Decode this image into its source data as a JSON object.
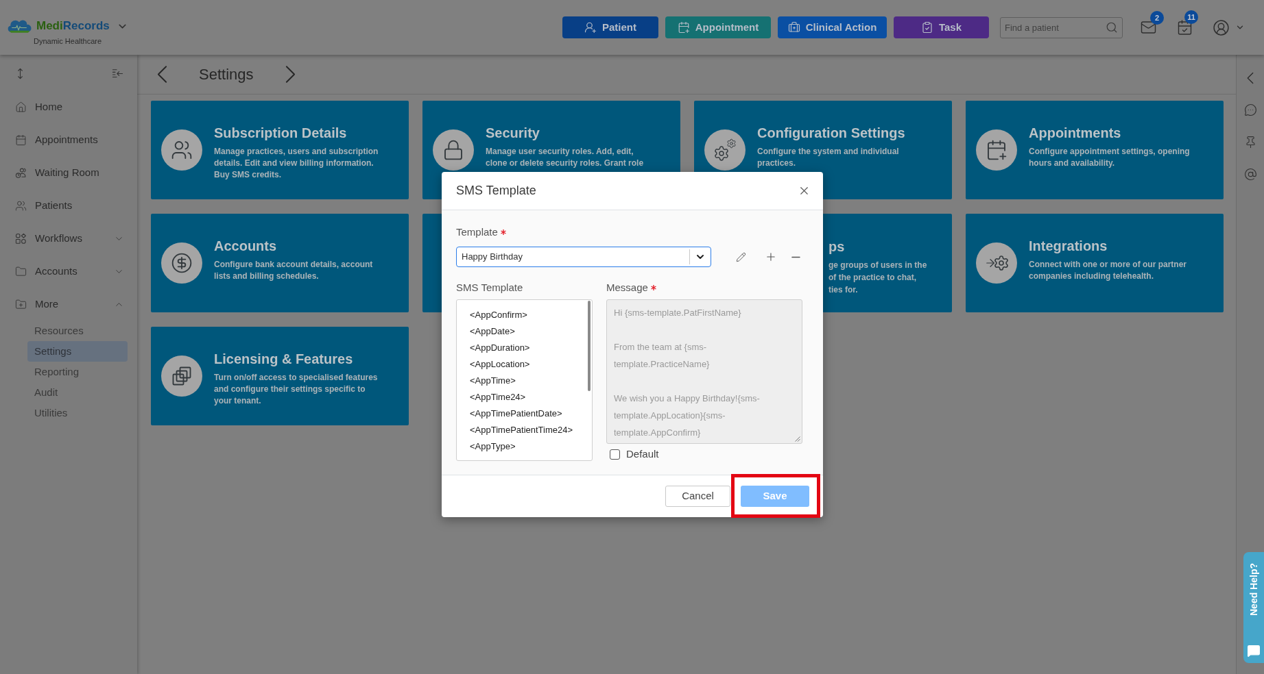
{
  "header": {
    "logo_parts": [
      "Medi",
      "Records"
    ],
    "subtitle": "Dynamic Healthcare",
    "actions": [
      {
        "label": "Patient"
      },
      {
        "label": "Appointment"
      },
      {
        "label": "Clinical Action"
      },
      {
        "label": "Task"
      }
    ],
    "search": {
      "placeholder": "Find a patient"
    },
    "notifications": [
      {
        "count": "2"
      },
      {
        "count": "11"
      }
    ]
  },
  "sidebar": {
    "items": [
      {
        "label": "Home",
        "kind": "link"
      },
      {
        "label": "Appointments",
        "kind": "link"
      },
      {
        "label": "Waiting Room",
        "kind": "link"
      },
      {
        "label": "Patients",
        "kind": "link"
      },
      {
        "label": "Workflows",
        "kind": "group",
        "expanded": false
      },
      {
        "label": "Accounts",
        "kind": "group",
        "expanded": false
      },
      {
        "label": "More",
        "kind": "group",
        "expanded": true,
        "children": [
          {
            "label": "Resources",
            "selected": false
          },
          {
            "label": "Settings",
            "selected": true
          },
          {
            "label": "Reporting",
            "selected": false
          },
          {
            "label": "Audit",
            "selected": false
          },
          {
            "label": "Utilities",
            "selected": false
          }
        ]
      }
    ]
  },
  "page": {
    "title": "Settings"
  },
  "cards": [
    {
      "kind": "full",
      "title": "Subscription Details",
      "description": "Manage practices, users and subscription details. Edit and view billing information. Buy SMS credits."
    },
    {
      "kind": "full",
      "title": "Security",
      "description": "Manage user security roles. Add, edit, clone or delete security roles. Grant role"
    },
    {
      "kind": "full",
      "title": "Configuration Settings",
      "description": "Configure the system and individual practices."
    },
    {
      "kind": "full",
      "title": "Appointments",
      "description": "Configure appointment settings, opening hours and availability."
    },
    {
      "kind": "full",
      "title": "Accounts",
      "description": "Configure bank account details, account lists and billing schedules."
    },
    {
      "kind": "covered"
    },
    {
      "kind": "partial",
      "title": "ps",
      "description_lines": [
        "ge groups of users in the",
        "of the practice to chat,",
        "ties for."
      ]
    },
    {
      "kind": "full",
      "title": "Integrations",
      "description": "Connect with one or more of our partner companies including telehealth."
    },
    {
      "kind": "full",
      "title": "Licensing & Features",
      "description": "Turn on/off access to specialised features and configure their settings specific to your tenant."
    }
  ],
  "dialog": {
    "title": "SMS Template",
    "template_field": {
      "label": "Template",
      "required": true,
      "value": "Happy Birthday"
    },
    "list": {
      "label": "SMS Template",
      "items": [
        "<AppConfirm>",
        "<AppDate>",
        "<AppDuration>",
        "<AppLocation>",
        "<AppTime>",
        "<AppTime24>",
        "<AppTimePatientDate>",
        "<AppTimePatientTime24>",
        "<AppType>"
      ]
    },
    "message": {
      "label": "Message",
      "required": true,
      "disabled": true,
      "value": "Hi {sms-template.PatFirstName}\n\nFrom the team at {sms-template.PracticeName}\n\nWe wish you a Happy Birthday!{sms-template.AppLocation}{sms-template.AppConfirm}"
    },
    "default_checkbox": {
      "label": "Default",
      "checked": false
    },
    "buttons": [
      {
        "label": "Cancel",
        "kind": "secondary",
        "disabled": false,
        "highlighted": false
      },
      {
        "label": "Save",
        "kind": "primary",
        "disabled": true,
        "highlighted": true
      }
    ]
  },
  "help_tab": {
    "label": "Need Help?"
  }
}
